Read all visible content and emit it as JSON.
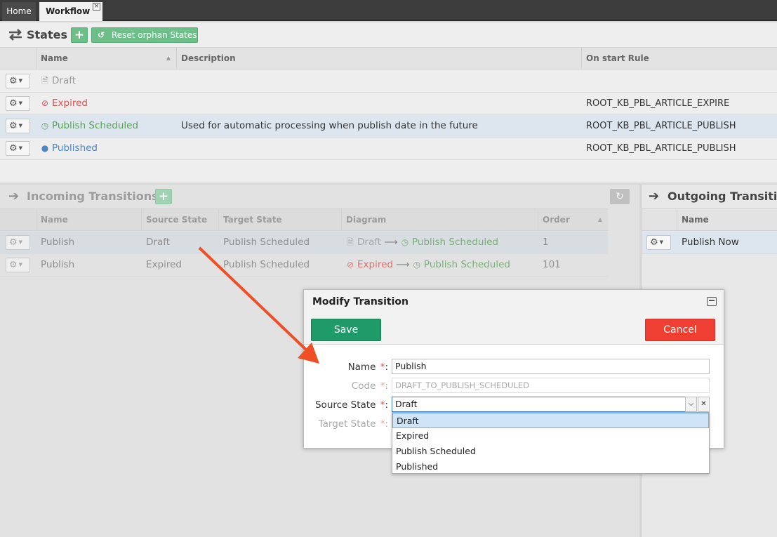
{
  "tabs": [
    {
      "label": "Home"
    },
    {
      "label": "Workflow",
      "close": "×"
    }
  ],
  "states": {
    "title": "States",
    "add_label": "+",
    "reset_label": "Reset orphan States",
    "columns": [
      "Name",
      "Description",
      "On start Rule"
    ],
    "rows": [
      {
        "icon": "file-icon",
        "name": "Draft",
        "description": "",
        "rule": ""
      },
      {
        "icon": "ban-icon",
        "name": "Expired",
        "description": "",
        "rule": "ROOT_KB_PBL_ARTICLE_EXPIRE"
      },
      {
        "icon": "clock-icon",
        "name": "Publish Scheduled",
        "description": "Used for automatic processing when publish date in the future",
        "rule": "ROOT_KB_PBL_ARTICLE_PUBLISH"
      },
      {
        "icon": "globe-icon",
        "name": "Published",
        "description": "",
        "rule": "ROOT_KB_PBL_ARTICLE_PUBLISH"
      }
    ]
  },
  "incoming": {
    "title": "Incoming Transitions",
    "add_label": "+",
    "columns": [
      "Name",
      "Source State",
      "Target State",
      "Diagram",
      "Order"
    ],
    "rows": [
      {
        "name": "Publish",
        "source": "Draft",
        "target": "Publish Scheduled",
        "diag_from": "Draft",
        "diag_to": "Publish Scheduled",
        "order": "1"
      },
      {
        "name": "Publish",
        "source": "Expired",
        "target": "Publish Scheduled",
        "diag_from": "Expired",
        "diag_to": "Publish Scheduled",
        "order": "101"
      }
    ]
  },
  "outgoing": {
    "title": "Outgoing Transitions",
    "columns": [
      "Name"
    ],
    "rows": [
      {
        "name": "Publish Now"
      }
    ]
  },
  "modal": {
    "title": "Modify Transition",
    "save_label": "Save",
    "cancel_label": "Cancel",
    "fields": {
      "name_label": "Name",
      "name_value": "Publish",
      "code_label": "Code",
      "code_value": "DRAFT_TO_PUBLISH_SCHEDULED",
      "source_label": "Source State",
      "source_value": "Draft",
      "target_label": "Target State",
      "required_mark": "*",
      "colon": ":"
    },
    "dropdown_options": [
      "Draft",
      "Expired",
      "Publish Scheduled",
      "Published"
    ],
    "dropdown_selected": "Draft"
  },
  "colors": {
    "save": "#1f9b6a",
    "cancel": "#ef3f32",
    "expired": "#d9534f",
    "scheduled": "#5a9f5a",
    "published": "#4f86c2",
    "annotation_arrow": "#f04e23"
  }
}
